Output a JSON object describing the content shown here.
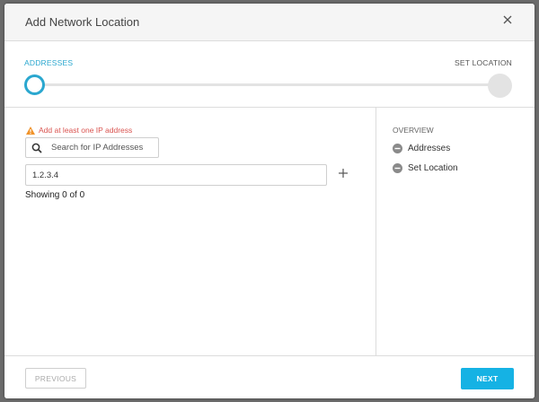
{
  "dialog": {
    "title": "Add Network Location",
    "close_icon": "close-icon"
  },
  "steps": {
    "active_label": "ADDRESSES",
    "next_label": "SET LOCATION",
    "accent_color": "#2aa7cf"
  },
  "addresses": {
    "warning": "Add at least one IP address",
    "warning_color": "#d9534f",
    "search_placeholder": "Search for IP Addresses",
    "ip_value": "1.2.3.4",
    "showing_text": "Showing 0 of 0"
  },
  "overview": {
    "title": "OVERVIEW",
    "items": [
      {
        "label": "Addresses",
        "icon": "minus-circle-icon"
      },
      {
        "label": "Set Location",
        "icon": "minus-circle-icon"
      }
    ]
  },
  "footer": {
    "previous_label": "PREVIOUS",
    "next_label": "NEXT",
    "next_color": "#15b2e4"
  }
}
